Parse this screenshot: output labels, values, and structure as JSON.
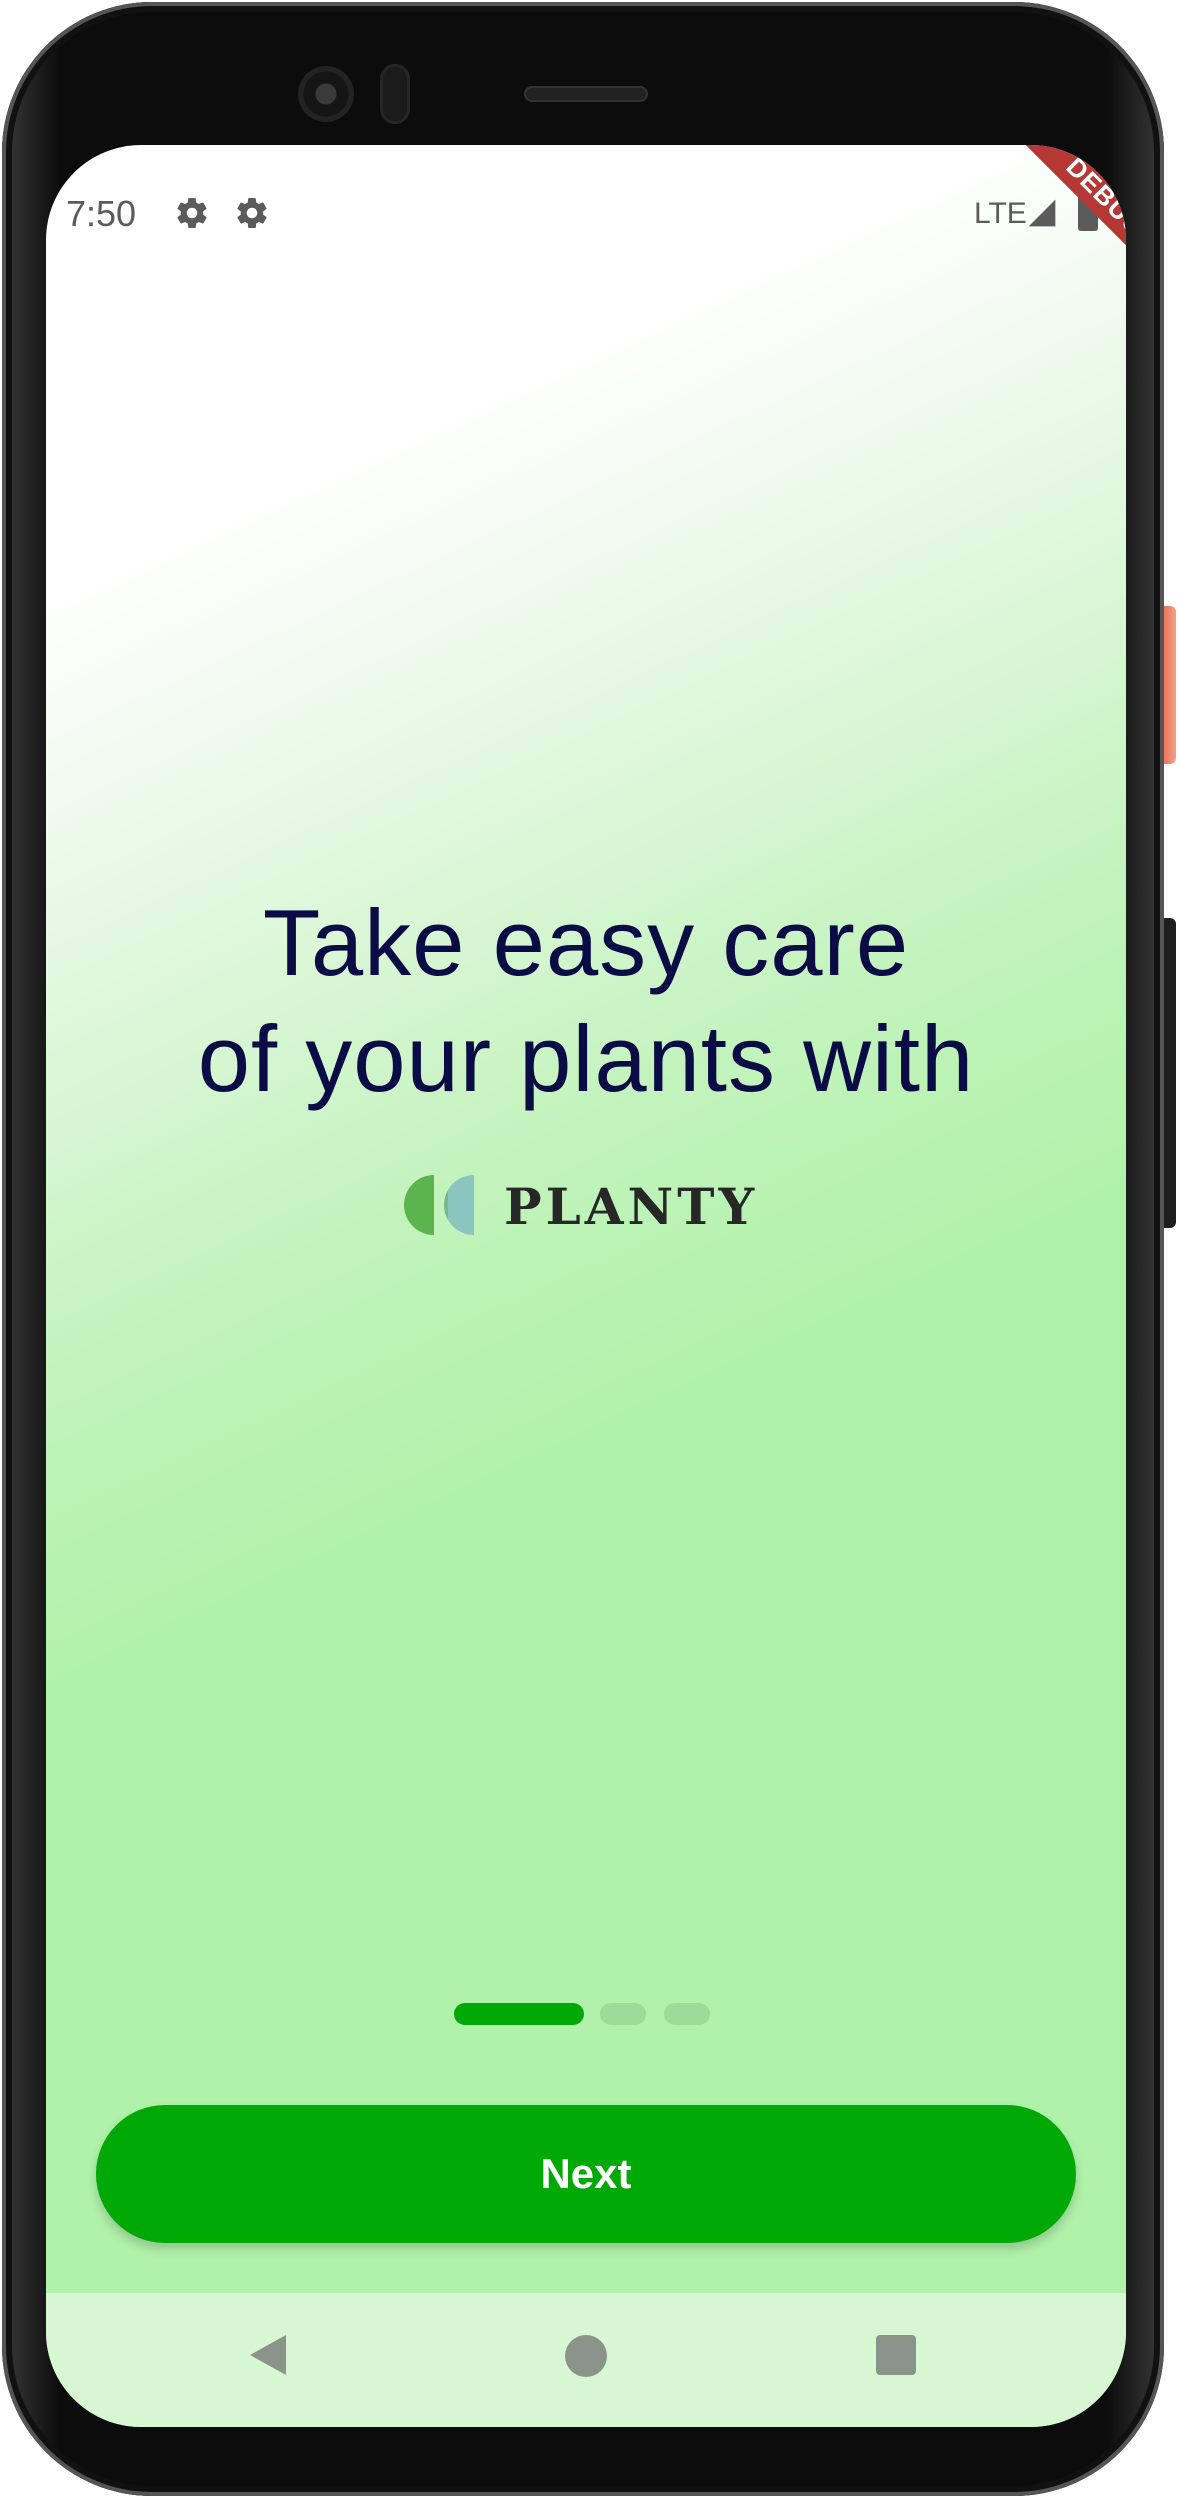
{
  "status_bar": {
    "time": "7:50",
    "network": "LTE",
    "icons": [
      "settings-gear-icon",
      "settings-gear-icon",
      "signal-icon",
      "battery-icon"
    ]
  },
  "debug_banner": "DEBUG",
  "onboarding": {
    "headline_line1": "Take easy care",
    "headline_line2": "of your plants with",
    "brand_name": "PLANTY",
    "page_indicator": {
      "total": 3,
      "current": 1
    }
  },
  "actions": {
    "next_label": "Next"
  },
  "nav_bar": {
    "icons": [
      "back-icon",
      "home-icon",
      "recents-icon"
    ]
  },
  "colors": {
    "primary_green": "#00a906",
    "headline": "#0b0b45",
    "background_green": "#b0f2aa",
    "nav_bar": "#d6f7d2",
    "logo_green": "#5bb44e",
    "logo_teal": "#8ac5c0",
    "debug_red": "#b53835"
  }
}
